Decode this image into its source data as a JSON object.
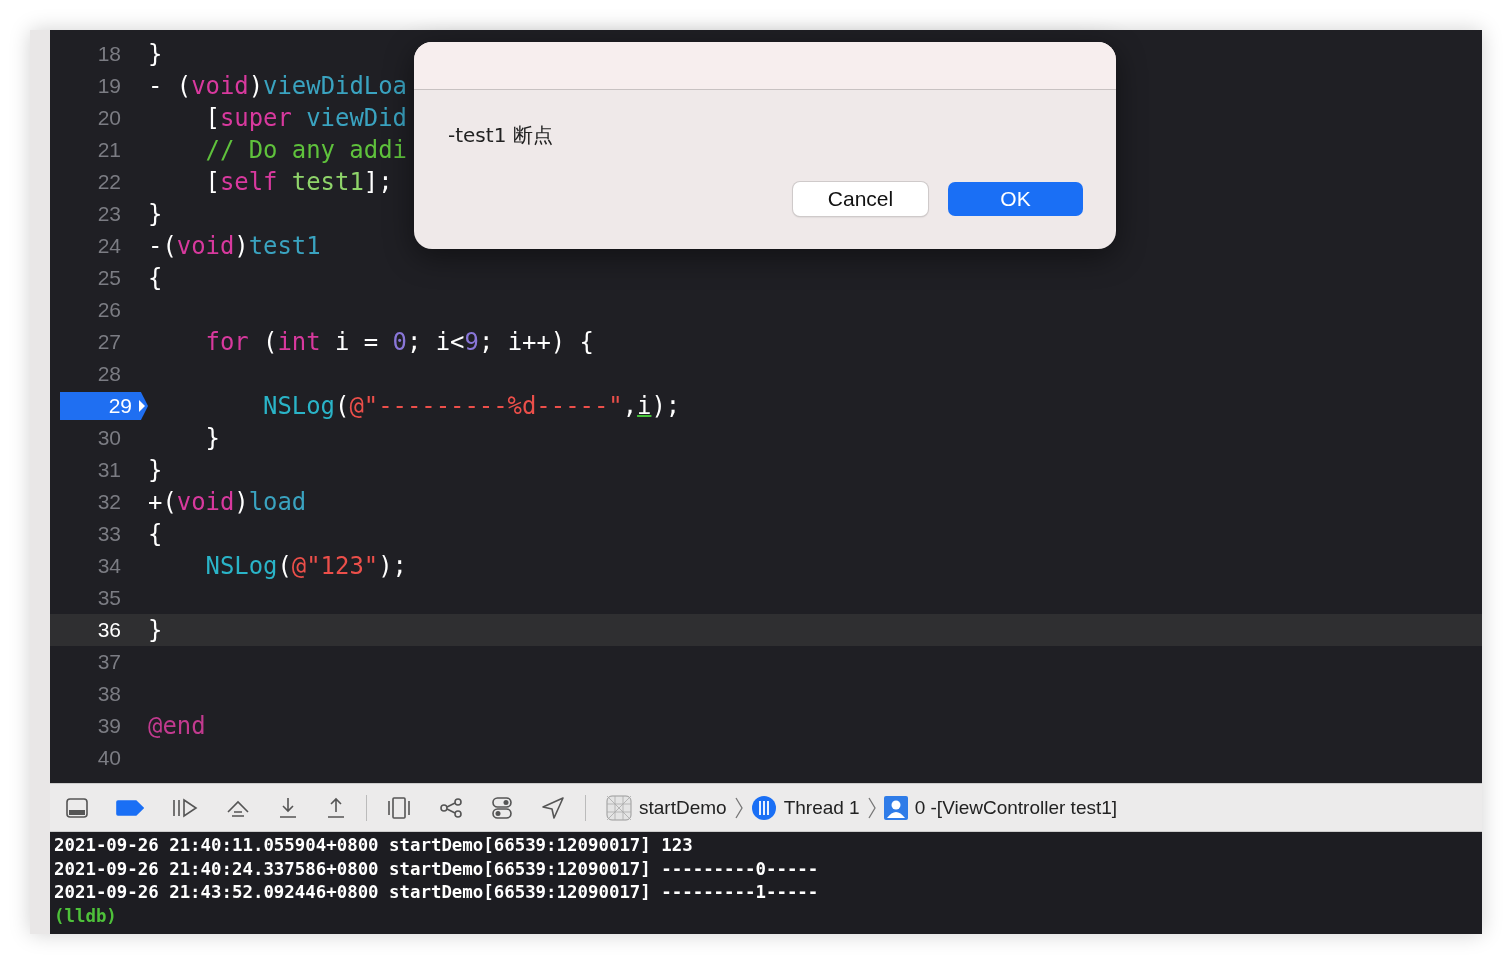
{
  "editor": {
    "lines": [
      {
        "number": "18",
        "breakpoint": false,
        "current": false,
        "tokens": [
          {
            "text": "}",
            "kind": "plain"
          }
        ]
      },
      {
        "number": "19",
        "breakpoint": false,
        "current": false,
        "tokens": [
          {
            "text": "- (",
            "kind": "plain"
          },
          {
            "text": "void",
            "kind": "keyword"
          },
          {
            "text": ")",
            "kind": "plain"
          },
          {
            "text": "viewDidLoa",
            "kind": "method"
          }
        ]
      },
      {
        "number": "20",
        "breakpoint": false,
        "current": false,
        "tokens": [
          {
            "text": "    [",
            "kind": "plain"
          },
          {
            "text": "super",
            "kind": "keyword"
          },
          {
            "text": " viewDid",
            "kind": "method"
          }
        ]
      },
      {
        "number": "21",
        "breakpoint": false,
        "current": false,
        "tokens": [
          {
            "text": "    // Do any addi",
            "kind": "comment"
          }
        ]
      },
      {
        "number": "22",
        "breakpoint": false,
        "current": false,
        "tokens": [
          {
            "text": "    [",
            "kind": "plain"
          },
          {
            "text": "self",
            "kind": "keyword"
          },
          {
            "text": " test1",
            "kind": "call"
          },
          {
            "text": "];",
            "kind": "plain"
          }
        ]
      },
      {
        "number": "23",
        "breakpoint": false,
        "current": false,
        "tokens": [
          {
            "text": "}",
            "kind": "plain"
          }
        ]
      },
      {
        "number": "24",
        "breakpoint": false,
        "current": false,
        "tokens": [
          {
            "text": "-(",
            "kind": "plain"
          },
          {
            "text": "void",
            "kind": "keyword"
          },
          {
            "text": ")",
            "kind": "plain"
          },
          {
            "text": "test1",
            "kind": "method"
          }
        ]
      },
      {
        "number": "25",
        "breakpoint": false,
        "current": false,
        "tokens": [
          {
            "text": "{",
            "kind": "plain"
          }
        ]
      },
      {
        "number": "26",
        "breakpoint": false,
        "current": false
      },
      {
        "number": "27",
        "breakpoint": false,
        "current": false,
        "tokens": [
          {
            "text": "    for",
            "kind": "keyword"
          },
          {
            "text": " (",
            "kind": "plain"
          },
          {
            "text": "int",
            "kind": "keyword"
          },
          {
            "text": " i = ",
            "kind": "plain"
          },
          {
            "text": "0",
            "kind": "number"
          },
          {
            "text": "; i<",
            "kind": "plain"
          },
          {
            "text": "9",
            "kind": "number"
          },
          {
            "text": "; i++) {",
            "kind": "plain"
          }
        ]
      },
      {
        "number": "28",
        "breakpoint": false,
        "current": false
      },
      {
        "number": "29",
        "breakpoint": true,
        "current": false,
        "tokens": [
          {
            "text": "        NSLog",
            "kind": "function"
          },
          {
            "text": "(",
            "kind": "plain"
          },
          {
            "text": "@\"---------%d-----\"",
            "kind": "string"
          },
          {
            "text": ",",
            "kind": "plain"
          },
          {
            "text": "i",
            "kind": "flagged"
          },
          {
            "text": ");",
            "kind": "plain"
          }
        ]
      },
      {
        "number": "30",
        "breakpoint": false,
        "current": false,
        "tokens": [
          {
            "text": "    }",
            "kind": "plain"
          }
        ]
      },
      {
        "number": "31",
        "breakpoint": false,
        "current": false,
        "tokens": [
          {
            "text": "}",
            "kind": "plain"
          }
        ]
      },
      {
        "number": "32",
        "breakpoint": false,
        "current": false,
        "tokens": [
          {
            "text": "+(",
            "kind": "plain"
          },
          {
            "text": "void",
            "kind": "keyword"
          },
          {
            "text": ")",
            "kind": "plain"
          },
          {
            "text": "load",
            "kind": "method"
          }
        ]
      },
      {
        "number": "33",
        "breakpoint": false,
        "current": false,
        "tokens": [
          {
            "text": "{",
            "kind": "plain"
          }
        ]
      },
      {
        "number": "34",
        "breakpoint": false,
        "current": false,
        "tokens": [
          {
            "text": "    NSLog",
            "kind": "function"
          },
          {
            "text": "(",
            "kind": "plain"
          },
          {
            "text": "@\"123\"",
            "kind": "string"
          },
          {
            "text": ");",
            "kind": "plain"
          }
        ]
      },
      {
        "number": "35",
        "breakpoint": false,
        "current": false
      },
      {
        "number": "36",
        "breakpoint": false,
        "current": true,
        "tokens": [
          {
            "text": "}",
            "kind": "plain"
          }
        ]
      },
      {
        "number": "37",
        "breakpoint": false,
        "current": false
      },
      {
        "number": "38",
        "breakpoint": false,
        "current": false
      },
      {
        "number": "39",
        "breakpoint": false,
        "current": false,
        "tokens": [
          {
            "text": "@end",
            "kind": "directive"
          }
        ]
      },
      {
        "number": "40",
        "breakpoint": false,
        "current": false
      }
    ]
  },
  "debug_bar": {
    "breakpoints_active": true,
    "breadcrumbs": [
      {
        "kind": "app",
        "label": "startDemo"
      },
      {
        "kind": "thread",
        "label": "Thread 1"
      },
      {
        "kind": "frame",
        "label": "0 -[ViewController test1]"
      }
    ]
  },
  "console": {
    "lines": [
      "2021-09-26 21:40:11.055904+0800 startDemo[66539:12090017] 123",
      "2021-09-26 21:40:24.337586+0800 startDemo[66539:12090017] ---------0-----",
      "2021-09-26 21:43:52.092446+0800 startDemo[66539:12090017] ---------1-----"
    ],
    "prompt": "(lldb)"
  },
  "dialog": {
    "message": "-test1 断点",
    "buttons": [
      {
        "label": "Cancel",
        "kind": "secondary"
      },
      {
        "label": "OK",
        "kind": "primary"
      }
    ]
  }
}
